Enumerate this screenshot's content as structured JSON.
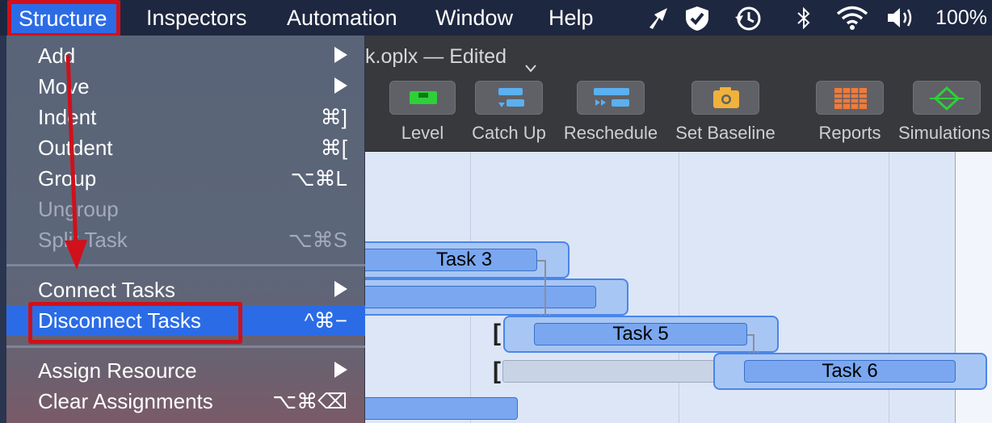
{
  "menubar": {
    "items": [
      {
        "label": "Structure"
      },
      {
        "label": "Inspectors"
      },
      {
        "label": "Automation"
      },
      {
        "label": "Window"
      },
      {
        "label": "Help"
      }
    ],
    "battery": "100%"
  },
  "window": {
    "title": "k.oplx — Edited"
  },
  "toolbar": {
    "buttons": [
      {
        "label": "Level",
        "icon": "level-icon",
        "color": "#2fcf3a"
      },
      {
        "label": "Catch Up",
        "icon": "catch-up-icon",
        "color": "#5ab0f0"
      },
      {
        "label": "Reschedule",
        "icon": "reschedule-icon",
        "color": "#5ab0f0"
      },
      {
        "label": "Set Baseline",
        "icon": "camera-icon",
        "color": "#f0b23a"
      },
      {
        "label": "Reports",
        "icon": "reports-icon",
        "color": "#f07a3a"
      },
      {
        "label": "Simulations",
        "icon": "simulations-icon",
        "color": "#2fcf3a"
      }
    ]
  },
  "menu": {
    "items": [
      {
        "label": "Add",
        "shortcut": "",
        "submenu": true,
        "enabled": true
      },
      {
        "label": "Move",
        "shortcut": "",
        "submenu": true,
        "enabled": true
      },
      {
        "label": "Indent",
        "shortcut": "⌘]",
        "submenu": false,
        "enabled": true
      },
      {
        "label": "Outdent",
        "shortcut": "⌘[",
        "submenu": false,
        "enabled": true
      },
      {
        "label": "Group",
        "shortcut": "⌥⌘L",
        "submenu": false,
        "enabled": true
      },
      {
        "label": "Ungroup",
        "shortcut": "",
        "submenu": false,
        "enabled": false
      },
      {
        "label": "Split Task",
        "shortcut": "⌥⌘S",
        "submenu": false,
        "enabled": false
      },
      {
        "label": "Connect Tasks",
        "shortcut": "",
        "submenu": true,
        "enabled": true
      },
      {
        "label": "Disconnect Tasks",
        "shortcut": "^⌘−",
        "submenu": false,
        "enabled": true,
        "selected": true
      },
      {
        "label": "Assign Resource",
        "shortcut": "",
        "submenu": true,
        "enabled": true
      },
      {
        "label": "Clear Assignments",
        "shortcut": "⌥⌘⌫",
        "submenu": false,
        "enabled": true
      }
    ]
  },
  "gantt": {
    "tasks": [
      {
        "label": "Task 3"
      },
      {
        "label": ""
      },
      {
        "label": "Task 5"
      },
      {
        "label": "Task 6"
      }
    ]
  },
  "annotation_color": "#d0101a"
}
